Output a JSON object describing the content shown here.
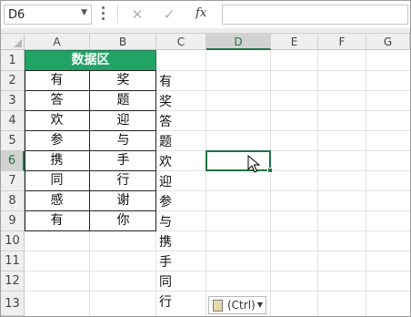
{
  "formula_bar": {
    "name_box": "D6",
    "cancel_icon": "✕",
    "enter_icon": "✓",
    "fx_label": "fx",
    "formula_value": ""
  },
  "columns": [
    "A",
    "B",
    "C",
    "D",
    "E",
    "F",
    "G"
  ],
  "selected_column": "D",
  "rows": [
    "1",
    "2",
    "3",
    "4",
    "5",
    "6",
    "7",
    "8",
    "9",
    "10",
    "11",
    "12",
    "13"
  ],
  "selected_row": "6",
  "table": {
    "header": "数据区",
    "rows": [
      [
        "有",
        "奖"
      ],
      [
        "答",
        "题"
      ],
      [
        "欢",
        "迎"
      ],
      [
        "参",
        "与"
      ],
      [
        "携",
        "手"
      ],
      [
        "同",
        "行"
      ],
      [
        "感",
        "谢"
      ],
      [
        "有",
        "你"
      ]
    ]
  },
  "column_c_text": [
    "有",
    "奖",
    "答",
    "题",
    "欢",
    "迎",
    "参",
    "与",
    "携",
    "手",
    "同",
    "行"
  ],
  "paste_options": {
    "label": "(Ctrl)",
    "icon": "clipboard-icon"
  },
  "colors": {
    "header_fill": "#21a366",
    "selection_accent": "#217346"
  }
}
